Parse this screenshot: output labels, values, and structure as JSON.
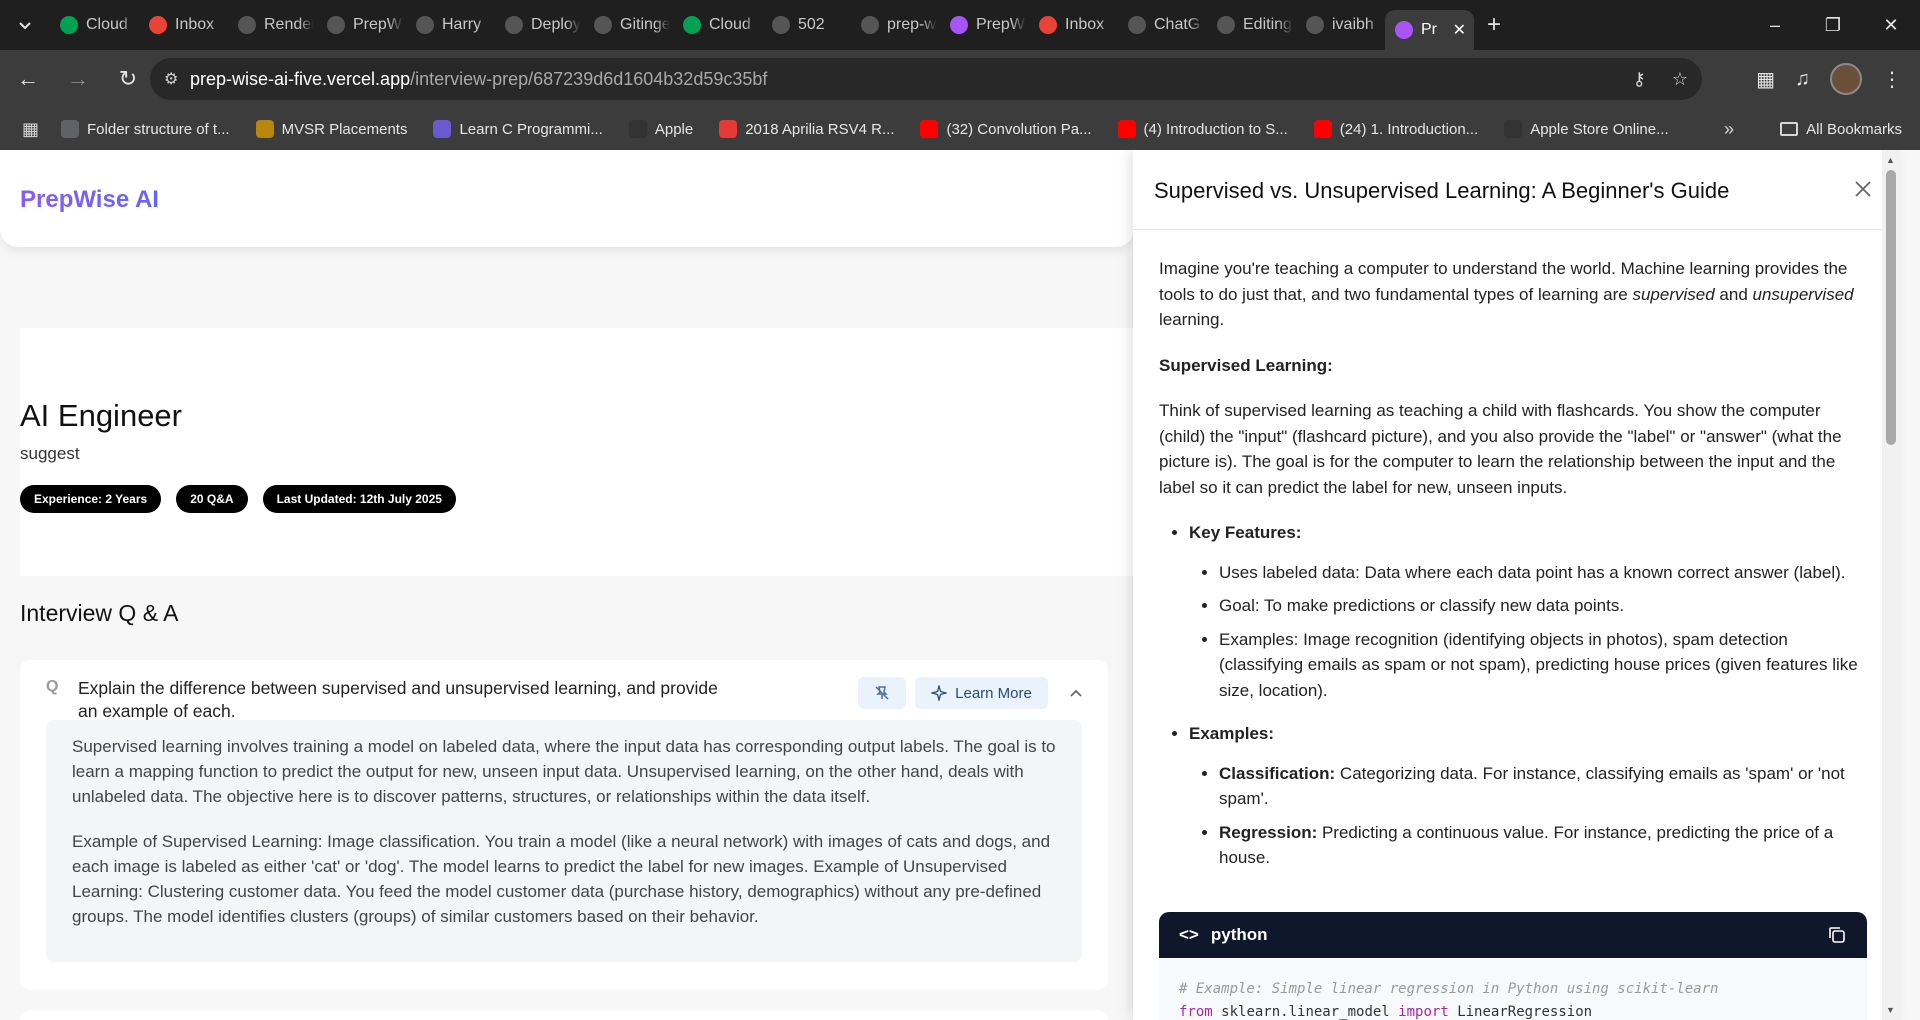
{
  "browser": {
    "tabs": [
      {
        "label": "Cloud",
        "icon": "mongodb-leaf-icon",
        "color": "#00a152"
      },
      {
        "label": "Inbox",
        "icon": "gmail-icon",
        "color": "#ea4335"
      },
      {
        "label": "Render",
        "icon": "render-icon",
        "color": "#ffffff"
      },
      {
        "label": "PrepW",
        "icon": "github-icon",
        "color": "#ffffff"
      },
      {
        "label": "Harry",
        "icon": "github-icon",
        "color": "#ffffff"
      },
      {
        "label": "Deploy",
        "icon": "openai-icon",
        "color": "#ffffff"
      },
      {
        "label": "Gitingest",
        "icon": "gitingest-icon",
        "color": "#ffffff"
      },
      {
        "label": "Cloud",
        "icon": "mongodb-leaf-icon",
        "color": "#00a152"
      },
      {
        "label": "502",
        "icon": "render-icon",
        "color": "#ffffff"
      },
      {
        "label": "prep-w",
        "icon": "vercel-icon",
        "color": "#ffffff"
      },
      {
        "label": "PrepW",
        "icon": "vite-icon",
        "color": "#a855f7"
      },
      {
        "label": "Inbox",
        "icon": "gmail-icon",
        "color": "#ea4335"
      },
      {
        "label": "ChatG",
        "icon": "openai-icon",
        "color": "#ffffff"
      },
      {
        "label": "Editing",
        "icon": "github-icon",
        "color": "#ffffff"
      },
      {
        "label": "ivaibh",
        "icon": "github-icon",
        "color": "#ffffff"
      },
      {
        "label": "Pr",
        "icon": "vite-icon",
        "color": "#a855f7",
        "active": true
      }
    ],
    "url_host": "prep-wise-ai-five.vercel.app",
    "url_path": "/interview-prep/687239d6d1604b32d59c35bf",
    "bookmarks": [
      {
        "label": "Folder structure of t...",
        "icon": "globe-icon",
        "color": "#5f6368"
      },
      {
        "label": "MVSR Placements",
        "icon": "mvsr-icon",
        "color": "#b8860b"
      },
      {
        "label": "Learn C Programmi...",
        "icon": "learn-c-icon",
        "color": "#6a5acd"
      },
      {
        "label": "Apple",
        "icon": "apple-icon",
        "color": "#333333"
      },
      {
        "label": "2018 Aprilia RSV4 R...",
        "icon": "aprilia-icon",
        "color": "#e53935"
      },
      {
        "label": "(32) Convolution Pa...",
        "icon": "youtube-icon",
        "color": "#ff0000"
      },
      {
        "label": "(4) Introduction to S...",
        "icon": "youtube-icon",
        "color": "#ff0000"
      },
      {
        "label": "(24) 1. Introduction...",
        "icon": "youtube-icon",
        "color": "#ff0000"
      },
      {
        "label": "Apple Store Online...",
        "icon": "apple-icon",
        "color": "#333333"
      }
    ],
    "all_bookmarks": "All Bookmarks"
  },
  "app": {
    "brand": "PrepWise AI",
    "role_title": "AI Engineer",
    "role_subtitle": "suggest",
    "pills": [
      "Experience: 2 Years",
      "20 Q&A",
      "Last Updated: 12th July 2025"
    ],
    "qa_heading": "Interview Q & A",
    "question_marker": "Q",
    "question": "Explain the difference between supervised and unsupervised learning, and provide an example of each.",
    "learn_more": "Learn More",
    "answer_p1": "Supervised learning involves training a model on labeled data, where the input data has corresponding output labels. The goal is to learn a mapping function to predict the output for new, unseen input data. Unsupervised learning, on the other hand, deals with unlabeled data. The objective here is to discover patterns, structures, or relationships within the data itself.",
    "answer_p2": "Example of Supervised Learning: Image classification. You train a model (like a neural network) with images of cats and dogs, and each image is labeled as either 'cat' or 'dog'. The model learns to predict the label for new images. Example of Unsupervised Learning: Clustering customer data. You feed the model customer data (purchase history, demographics) without any pre-defined groups. The model identifies clusters (groups) of similar customers based on their behavior."
  },
  "drawer": {
    "title": "Supervised vs. Unsupervised Learning: A Beginner's Guide",
    "intro_a": "Imagine you're teaching a computer to understand the world. Machine learning provides the tools to do just that, and two fundamental types of learning are ",
    "intro_em1": "supervised",
    "intro_and": " and ",
    "intro_em2": "unsupervised",
    "intro_end": " learning.",
    "sup_heading": "Supervised Learning:",
    "sup_para": "Think of supervised learning as teaching a child with flashcards. You show the computer (child) the \"input\" (flashcard picture), and you also provide the \"label\" or \"answer\" (what the picture is). The goal is for the computer to learn the relationship between the input and the label so it can predict the label for new, unseen inputs.",
    "key_features_label": "Key Features:",
    "key_features": [
      "Uses labeled data: Data where each data point has a known correct answer (label).",
      "Goal: To make predictions or classify new data points.",
      "Examples: Image recognition (identifying objects in photos), spam detection (classifying emails as spam or not spam), predicting house prices (given features like size, location)."
    ],
    "examples_label": "Examples:",
    "examples": [
      {
        "term": "Classification:",
        "text": " Categorizing data. For instance, classifying emails as 'spam' or 'not spam'."
      },
      {
        "term": "Regression:",
        "text": " Predicting a continuous value. For instance, predicting the price of a house."
      }
    ],
    "code_lang": "python",
    "code_comment": "# Example: Simple linear regression in Python using scikit-learn",
    "code_from": "from",
    "code_module": "sklearn.linear_model",
    "code_import": "import",
    "code_name": "LinearRegression"
  }
}
